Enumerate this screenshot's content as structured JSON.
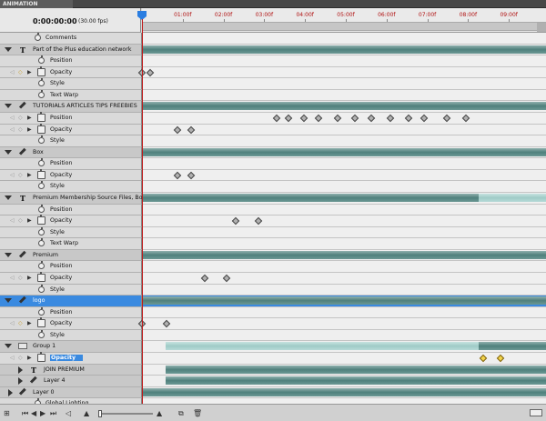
{
  "panel": {
    "tab_label": "ANIMATION (TIMELINE)",
    "timecode": "0:00:00:00",
    "fps": "(30.00 fps)"
  },
  "ruler": {
    "labels": [
      "01:00f",
      "02:00f",
      "03:00f",
      "04:00f",
      "05:00f",
      "06:00f",
      "07:00f",
      "08:00f",
      "09:00f"
    ]
  },
  "rows": [
    {
      "label": "Comments",
      "kind": "prop-top",
      "icon": "stopwatch-icon"
    },
    {
      "label": "Part of the Plus education network",
      "kind": "layer",
      "icon": "text-layer-icon",
      "bar": "full"
    },
    {
      "label": "Position",
      "kind": "prop"
    },
    {
      "label": "Opacity",
      "kind": "prop-key",
      "dia": true,
      "keys": [
        0,
        0.2
      ]
    },
    {
      "label": "Style",
      "kind": "prop"
    },
    {
      "label": "Text Warp",
      "kind": "prop"
    },
    {
      "label": "TUTORIALS ARTICLES TIPS FREEBIES",
      "kind": "layer",
      "icon": "brush-layer-icon",
      "bar": "full"
    },
    {
      "label": "Position",
      "kind": "prop-key",
      "keys": [
        3.3,
        3.6,
        3.97,
        4.33,
        4.8,
        5.23,
        5.63,
        6.1,
        6.53,
        6.93,
        7.47,
        7.95
      ]
    },
    {
      "label": "Opacity",
      "kind": "prop-key",
      "keys": [
        0.88,
        1.2
      ]
    },
    {
      "label": "Style",
      "kind": "prop"
    },
    {
      "label": "Box",
      "kind": "layer",
      "icon": "brush-layer-icon",
      "bar": "full"
    },
    {
      "label": "Position",
      "kind": "prop"
    },
    {
      "label": "Opacity",
      "kind": "prop-key",
      "keys": [
        0.88,
        1.2
      ]
    },
    {
      "label": "Style",
      "kind": "prop"
    },
    {
      "label": "Premium Membership Source Files, Bonus",
      "kind": "layer",
      "icon": "text-layer-icon",
      "bar": "split",
      "split_at": 8.27
    },
    {
      "label": "Position",
      "kind": "prop"
    },
    {
      "label": "Opacity",
      "kind": "prop-key",
      "keys": [
        2.3,
        2.85
      ]
    },
    {
      "label": "Style",
      "kind": "prop"
    },
    {
      "label": "Text Warp",
      "kind": "prop"
    },
    {
      "label": "Premium",
      "kind": "layer",
      "icon": "brush-layer-icon",
      "bar": "full"
    },
    {
      "label": "Position",
      "kind": "prop"
    },
    {
      "label": "Opacity",
      "kind": "prop-key",
      "keys": [
        1.53,
        2.07
      ]
    },
    {
      "label": "Style",
      "kind": "prop"
    },
    {
      "label": "logo",
      "kind": "layer-sel",
      "icon": "brush-layer-icon",
      "bar": "full"
    },
    {
      "label": "Position",
      "kind": "prop"
    },
    {
      "label": "Opacity",
      "kind": "prop-key",
      "dia": true,
      "keys": [
        0,
        0.6
      ]
    },
    {
      "label": "Style",
      "kind": "prop"
    },
    {
      "label": "Group 1",
      "kind": "group",
      "icon": "folder-icon",
      "bar": "group",
      "split_at": 8.27
    },
    {
      "label": "Opacity",
      "kind": "prop-key-sel",
      "keys": [
        8.37,
        8.8
      ],
      "yellow": true
    },
    {
      "label": "JOIN PREMIUM",
      "kind": "sublayer",
      "icon": "text-layer-icon",
      "bar": "sub"
    },
    {
      "label": "Layer 4",
      "kind": "sublayer",
      "icon": "brush-layer-icon",
      "bar": "sub"
    },
    {
      "label": "Layer 0",
      "kind": "layer-closed",
      "icon": "brush-layer-icon",
      "bar": "full"
    },
    {
      "label": "Global Lighting",
      "kind": "prop-top",
      "icon": "stopwatch-icon"
    }
  ]
}
